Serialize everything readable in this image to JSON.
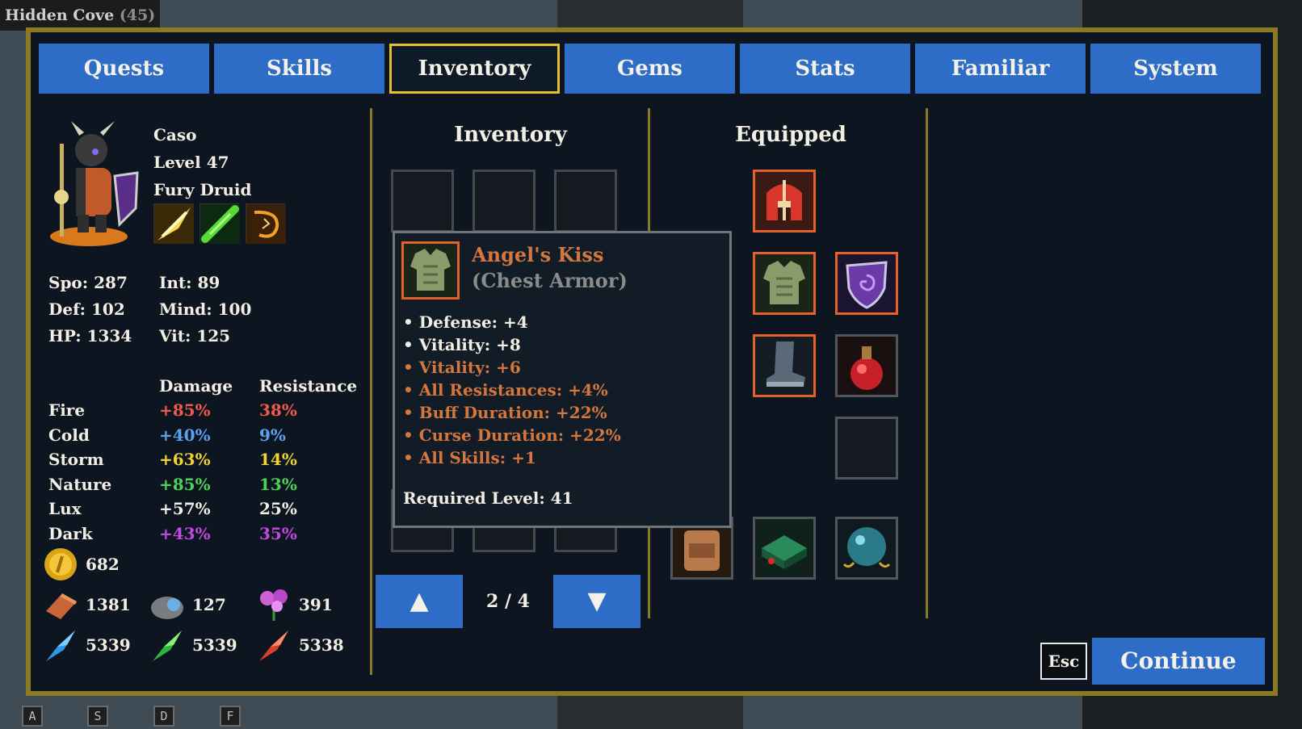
{
  "location": {
    "name": "Hidden Cove",
    "level": "(45)"
  },
  "hotkeys": [
    "A",
    "S",
    "D",
    "F"
  ],
  "tabs": [
    "Quests",
    "Skills",
    "Inventory",
    "Gems",
    "Stats",
    "Familiar",
    "System"
  ],
  "active_tab": "Inventory",
  "character": {
    "name": "Caso",
    "level": "Level 47",
    "class": "Fury Druid",
    "skills": [
      "light-slash-icon",
      "nature-bolt-icon",
      "storm-hook-icon"
    ]
  },
  "attributes": [
    {
      "label": "Spo: 287"
    },
    {
      "label": "Int: 89"
    },
    {
      "label": "Def: 102"
    },
    {
      "label": "Mind: 100"
    },
    {
      "label": "HP: 1334"
    },
    {
      "label": "Vit: 125"
    }
  ],
  "elements": {
    "headers": {
      "damage": "Damage",
      "resistance": "Resistance"
    },
    "rows": [
      {
        "name": "Fire",
        "damage": "+85%",
        "resistance": "38%",
        "color": "#f05a4a"
      },
      {
        "name": "Cold",
        "damage": "+40%",
        "resistance": "9%",
        "color": "#5aa3f0"
      },
      {
        "name": "Storm",
        "damage": "+63%",
        "resistance": "14%",
        "color": "#f2d233"
      },
      {
        "name": "Nature",
        "damage": "+85%",
        "resistance": "13%",
        "color": "#4ed35a"
      },
      {
        "name": "Lux",
        "damage": "+57%",
        "resistance": "25%",
        "color": "#f2eee4"
      },
      {
        "name": "Dark",
        "damage": "+43%",
        "resistance": "35%",
        "color": "#c04ae0"
      }
    ]
  },
  "currency": [
    {
      "icon": "gold-coin-icon",
      "value": "682"
    },
    {
      "icon": "iron-bar-icon",
      "value": "1381"
    },
    {
      "icon": "orb-stone-icon",
      "value": "127"
    },
    {
      "icon": "flower-herb-icon",
      "value": "391"
    },
    {
      "icon": "blue-crystal-icon",
      "value": "5339"
    },
    {
      "icon": "green-crystal-icon",
      "value": "5339"
    },
    {
      "icon": "red-crystal-icon",
      "value": "5338"
    }
  ],
  "inventory": {
    "title": "Inventory",
    "page": "2 / 4",
    "up_label": "▲",
    "down_label": "▼"
  },
  "equipped": {
    "title": "Equipped",
    "slots": [
      "helmet-icon",
      "chest-armor-icon",
      "shield-icon",
      "boots-icon",
      "potion-icon",
      "empty-slot",
      "backpack-icon",
      "chest-box-icon",
      "orb-amulet-icon"
    ]
  },
  "tooltip": {
    "name": "Angel's Kiss",
    "type": "(Chest Armor)",
    "stats": [
      {
        "text": "• Defense: +4",
        "kind": "base"
      },
      {
        "text": "• Vitality: +8",
        "kind": "base"
      },
      {
        "text": "• Vitality: +6",
        "kind": "bonus"
      },
      {
        "text": "• All Resistances: +4%",
        "kind": "bonus"
      },
      {
        "text": "• Buff Duration: +22%",
        "kind": "bonus"
      },
      {
        "text": "• Curse Duration: +22%",
        "kind": "bonus"
      },
      {
        "text": "• All Skills: +1",
        "kind": "bonus"
      }
    ],
    "required_level": "Required Level: 41"
  },
  "buttons": {
    "esc": "Esc",
    "continue": "Continue"
  }
}
